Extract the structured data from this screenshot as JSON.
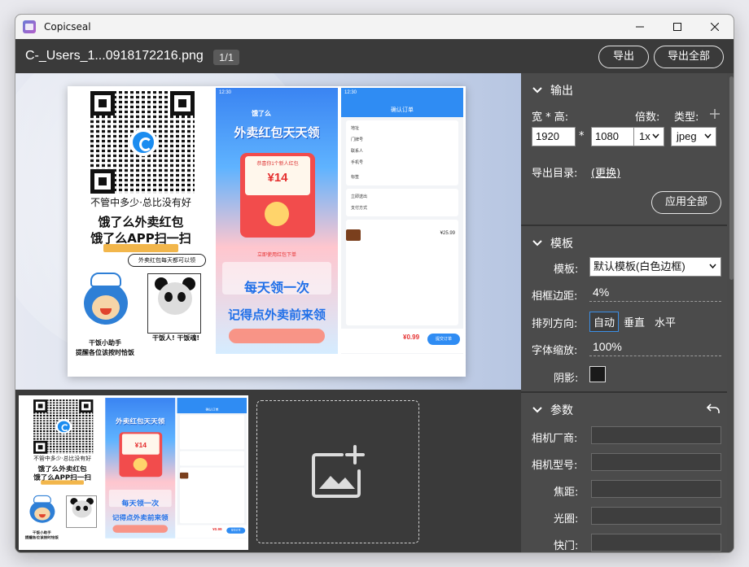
{
  "window": {
    "title": "Copicseal",
    "controls": [
      "minimize-icon",
      "maximize-icon",
      "close-icon"
    ]
  },
  "header": {
    "file_name": "C-_Users_1...0918172216.png",
    "page_indicator": "1/1",
    "export_label": "导出",
    "export_all_label": "导出全部"
  },
  "composite": {
    "poster": {
      "line1": "不管中多少·总比没有好",
      "line2": "饿了么外卖红包",
      "line3": "饿了么APP扫一扫",
      "banner": "外卖红包每天都可以领",
      "caption_left_1": "干饭小助手",
      "caption_left_2": "提醒各位该按时恰饭",
      "caption_right": "干饭人! 干饭魂!"
    },
    "promo": {
      "time": "12:30",
      "brand": "饿了么",
      "headline": "外卖红包天天领",
      "card_sub": "恭喜你1个新人红包",
      "amount": "¥14",
      "under": "立即使用红包下单",
      "big1": "每天领一次",
      "big2": "记得点外卖前来领"
    },
    "order": {
      "time": "12:30",
      "title": "确认订单",
      "lines": [
        "地址",
        "门牌号",
        "联系人",
        "手机号",
        "标签"
      ],
      "delivery": "立即送出",
      "payment": "支付方式",
      "item_price": "¥25.99",
      "total": "¥0.99",
      "submit": "提交订单"
    }
  },
  "sidebar": {
    "output": {
      "title": "输出",
      "size_label": "宽 * 高:",
      "width": "1920",
      "times": "*",
      "height": "1080",
      "scale_label": "倍数:",
      "scale_value": "1x",
      "type_label": "类型:",
      "type_value": "jpeg",
      "dir_label": "导出目录:",
      "dir_change": "(更换)",
      "apply_all": "应用全部"
    },
    "template": {
      "title": "模板",
      "template_label": "模板:",
      "template_value": "默认模板(白色边框)",
      "margin_label": "相框边距:",
      "margin_value": "4%",
      "direction_label": "排列方向:",
      "directions": [
        "自动",
        "垂直",
        "水平"
      ],
      "active_direction": "自动",
      "font_scale_label": "字体缩放:",
      "font_scale_value": "100%",
      "shadow_label": "阴影:"
    },
    "params": {
      "title": "参数",
      "fields": [
        "相机厂商:",
        "相机型号:",
        "焦距:",
        "光圈:",
        "快门:"
      ]
    }
  },
  "colors": {
    "window_bg": "#3a3a3a",
    "sidebar_bg": "#4b4b4b",
    "accent_border": "#3b8fe6",
    "promo_blue": "#1f6fe8",
    "price_red": "#e53030"
  }
}
